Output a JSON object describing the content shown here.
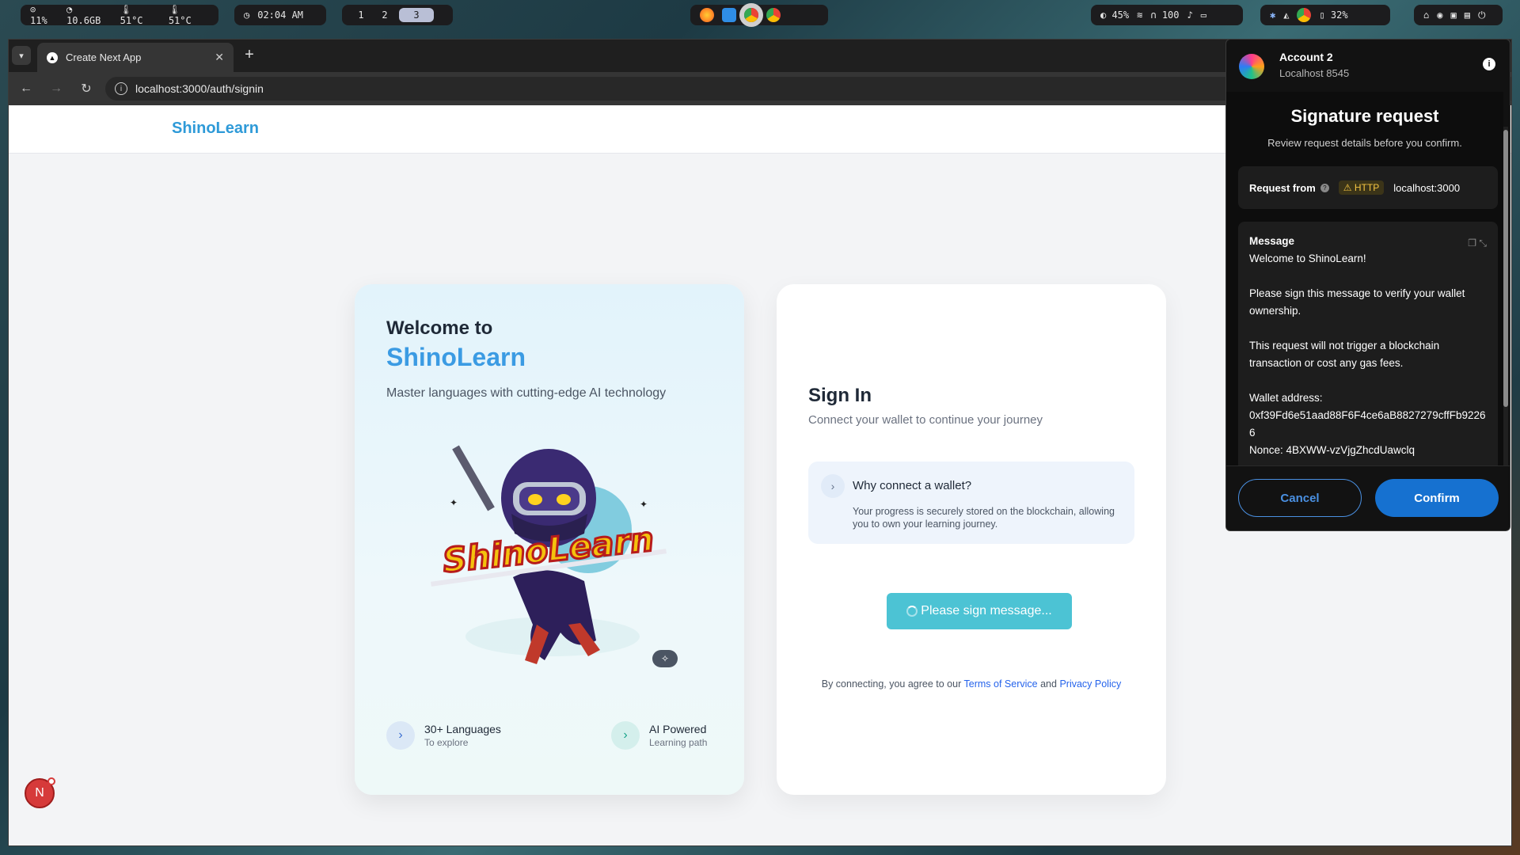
{
  "system_bar": {
    "cpu": "11%",
    "mem": "10.6GB",
    "temp1": "51°C",
    "temp2": "51°C",
    "clock": "02:04 AM",
    "workspaces": [
      "1",
      "2",
      "3"
    ],
    "active_workspace": "3",
    "brightness": "45%",
    "volume": "100",
    "battery": "32%"
  },
  "browser": {
    "tab_title": "Create Next App",
    "new_tab": "+",
    "url": "localhost:3000/auth/signin"
  },
  "page": {
    "brand": "ShinoLearn",
    "left_card": {
      "welcome": "Welcome to",
      "brand": "ShinoLearn",
      "tagline": "Master languages with cutting-edge AI technology",
      "mascot_text": "ShinoLearn",
      "features": [
        {
          "title": "30+ Languages",
          "subtitle": "To explore"
        },
        {
          "title": "AI Powered",
          "subtitle": "Learning path"
        }
      ]
    },
    "right_card": {
      "title": "Sign In",
      "subtitle": "Connect your wallet to continue your journey",
      "why_title": "Why connect a wallet?",
      "why_text": "Your progress is securely stored on the blockchain, allowing you to own your learning journey.",
      "button_label": "Please sign message...",
      "terms_prefix": "By connecting, you agree to our",
      "terms_link": "Terms of Service",
      "terms_and": "and",
      "privacy_link": "Privacy Policy"
    },
    "next_badge": "N"
  },
  "wallet": {
    "account": "Account 2",
    "network": "Localhost 8545",
    "title": "Signature request",
    "subtitle": "Review request details before you confirm.",
    "request_from_label": "Request from",
    "http_badge": "HTTP",
    "request_host": "localhost:3000",
    "message_label": "Message",
    "message_lines": {
      "l1": "Welcome to ShinoLearn!",
      "l2": "Please sign this message to verify your wallet ownership.",
      "l3": "This request will not trigger a blockchain transaction or cost any gas fees.",
      "l4": "Wallet address:",
      "l5": "0xf39Fd6e51aad88F6F4ce6aB8827279cffFb92266",
      "l6": "Nonce: 4BXWW-vzVjgZhcdUawclq"
    },
    "cancel_label": "Cancel",
    "confirm_label": "Confirm"
  },
  "colors": {
    "brand_blue": "#2e9ad8",
    "accent_teal": "#4cc3d4",
    "wallet_confirm": "#1671d0",
    "link_blue": "#2563eb"
  }
}
